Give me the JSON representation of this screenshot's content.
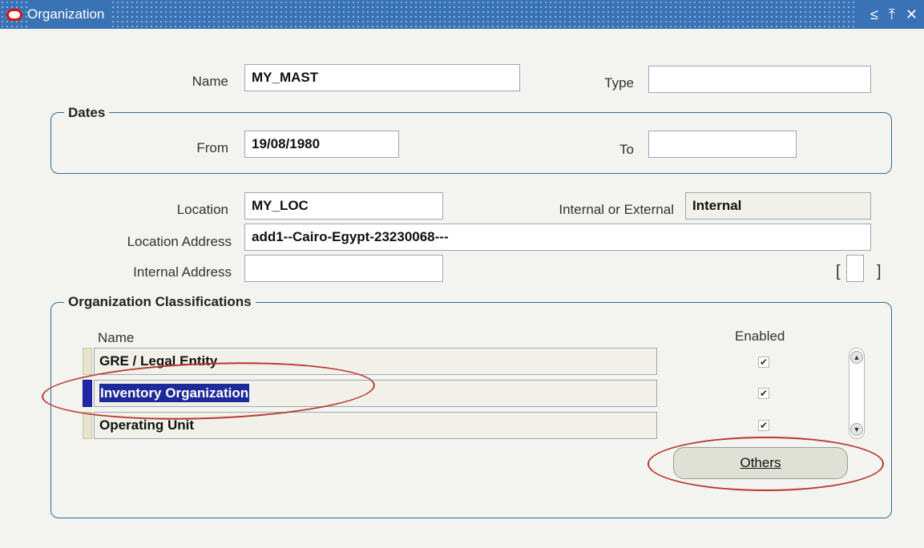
{
  "window": {
    "title": "Organization",
    "controls": [
      "≤",
      "⤒",
      "✕"
    ]
  },
  "form": {
    "name_label": "Name",
    "name_value": "MY_MAST",
    "type_label": "Type",
    "type_value": "",
    "dates": {
      "title": "Dates",
      "from_label": "From",
      "from_value": "19/08/1980",
      "to_label": "To",
      "to_value": ""
    },
    "location_label": "Location",
    "location_value": "MY_LOC",
    "int_ext_label": "Internal or External",
    "int_ext_value": "Internal",
    "location_address_label": "Location Address",
    "location_address_value": "add1--Cairo-Egypt-23230068---",
    "internal_address_label": "Internal Address",
    "internal_address_value": "",
    "bracket_left": "[",
    "bracket_right": "]"
  },
  "classifications": {
    "title": "Organization Classifications",
    "name_header": "Name",
    "enabled_header": "Enabled",
    "rows": [
      {
        "name": "GRE / Legal Entity",
        "enabled": true
      },
      {
        "name": "Inventory Organization",
        "enabled": true
      },
      {
        "name": "Operating Unit",
        "enabled": true
      }
    ],
    "others_button": "Others"
  },
  "annotation_color": "#b8372f",
  "selection_color": "#1d2a9a",
  "titlebar_color": "#3a73b5"
}
